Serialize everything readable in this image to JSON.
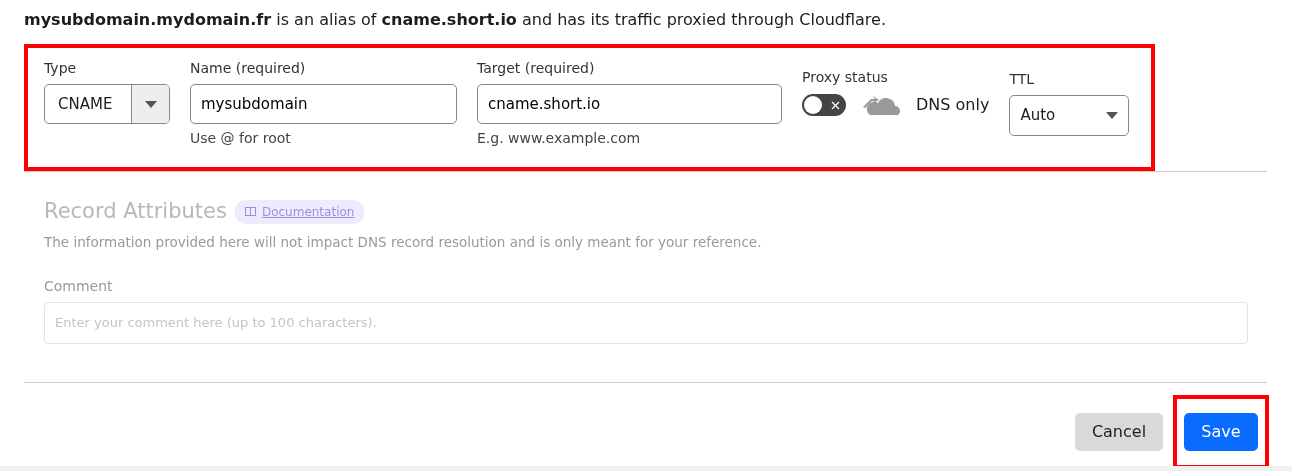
{
  "summary": "**mysubdomain.mydomain.fr** is an alias of **cname.short.io** and has its traffic proxied through Cloudflare.",
  "record": {
    "type": {
      "label": "Type",
      "value": "CNAME"
    },
    "name": {
      "label": "Name (required)",
      "value": "mysubdomain",
      "help": "Use @ for root"
    },
    "target": {
      "label": "Target (required)",
      "value": "cname.short.io",
      "help": "E.g. www.example.com"
    },
    "proxy": {
      "label": "Proxy status",
      "on": false,
      "status": "DNS only"
    },
    "ttl": {
      "label": "TTL",
      "value": "Auto"
    }
  },
  "attributes": {
    "title": "Record Attributes",
    "doc_link": "Documentation",
    "description": "The information provided here will not impact DNS record resolution and is only meant for your reference.",
    "comment_label": "Comment",
    "comment_placeholder": "Enter your comment here (up to 100 characters)."
  },
  "buttons": [
    {
      "label": "Cancel",
      "kind": "secondary"
    },
    {
      "label": "Save",
      "kind": "primary"
    }
  ]
}
